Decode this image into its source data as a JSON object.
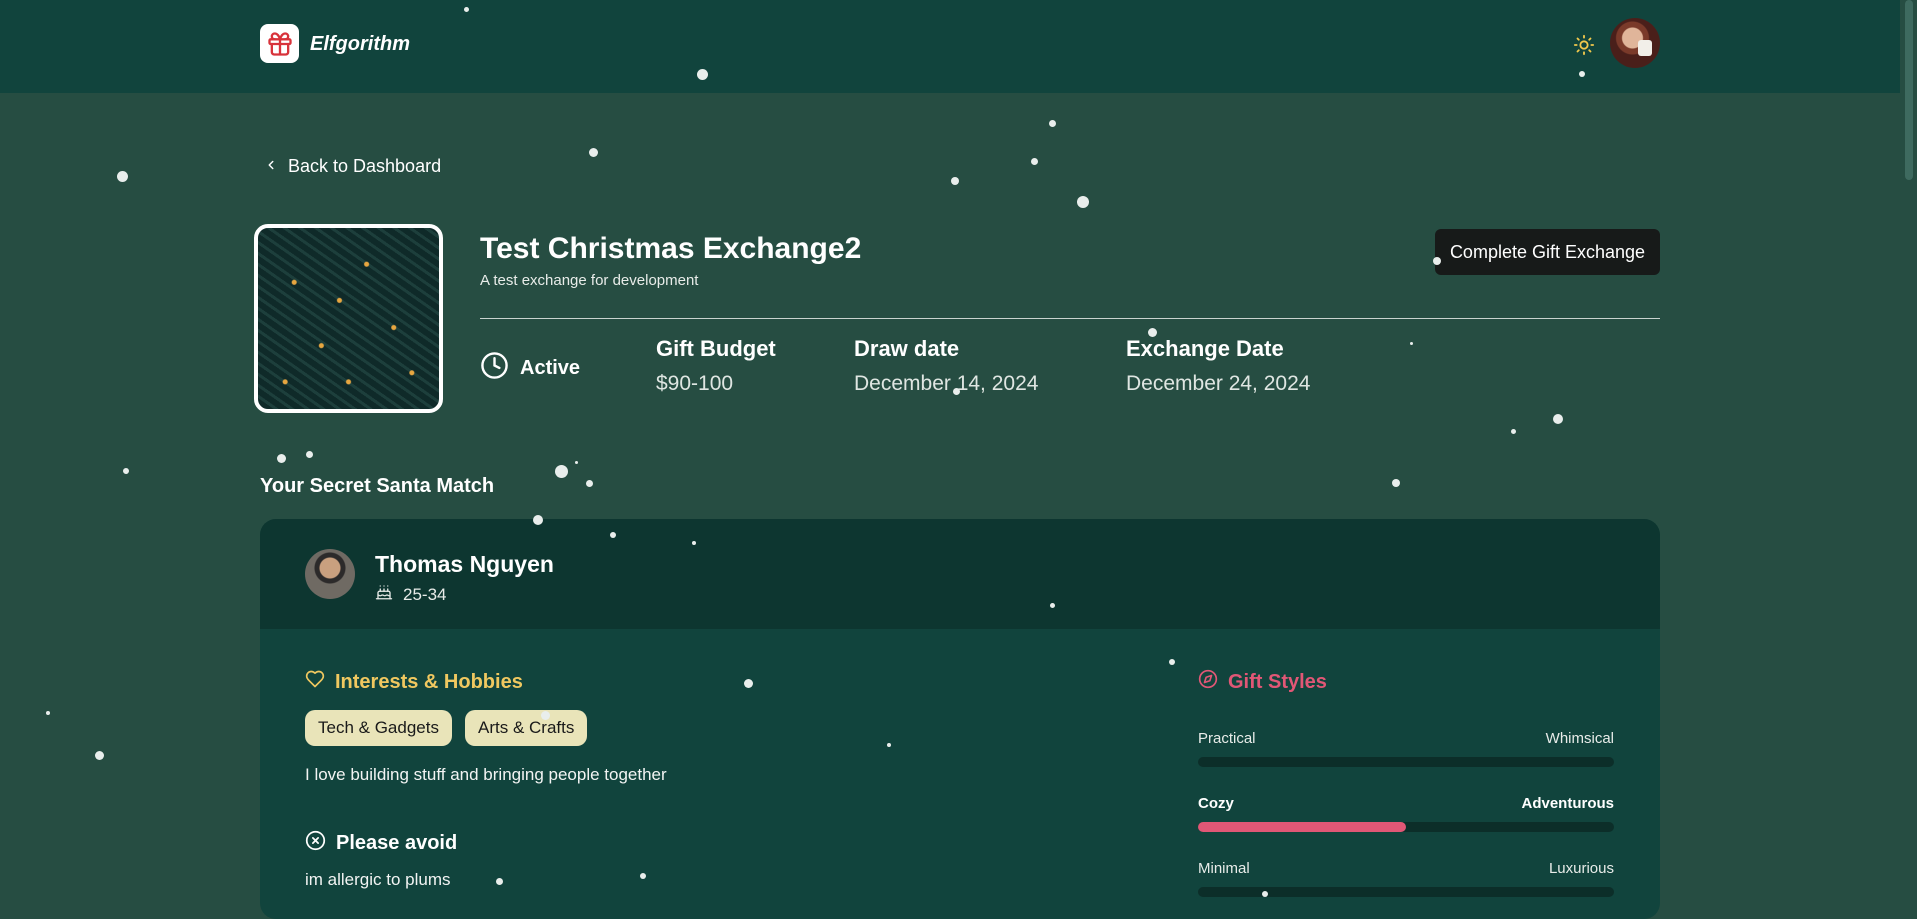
{
  "app": {
    "brand": "Elfgorithm"
  },
  "nav": {
    "back_label": "Back to Dashboard"
  },
  "exchange": {
    "title": "Test Christmas Exchange2",
    "description": "A test exchange for development",
    "complete_button": "Complete Gift Exchange",
    "status": "Active",
    "stats": [
      {
        "label": "Gift Budget",
        "value": "$90-100"
      },
      {
        "label": "Draw date",
        "value": "December 14, 2024"
      },
      {
        "label": "Exchange Date",
        "value": "December 24, 2024"
      }
    ]
  },
  "match": {
    "section_title": "Your Secret Santa Match",
    "name": "Thomas Nguyen",
    "age_range": "25-34",
    "interests_title": "Interests & Hobbies",
    "tags": [
      "Tech & Gadgets",
      "Arts & Crafts"
    ],
    "interests_text": "I love building stuff and bringing people together",
    "avoid_title": "Please avoid",
    "avoid_text": "im allergic to plums",
    "gift_styles_title": "Gift Styles",
    "gift_styles": [
      {
        "left": "Practical",
        "right": "Whimsical",
        "fill": 0
      },
      {
        "left": "Cozy",
        "right": "Adventurous",
        "fill": 0.5
      },
      {
        "left": "Minimal",
        "right": "Luxurious",
        "fill": 0
      }
    ]
  },
  "colors": {
    "page_bg": "#264d42",
    "header_bg": "#11443d",
    "card_bg": "#11443d",
    "interest_accent": "#f0c860",
    "gift_style_accent": "#e15776",
    "tag_bg": "#e9e4b9"
  },
  "icons": {
    "logo": "gift-icon",
    "theme": "sun-icon",
    "back": "chevron-left-icon",
    "status": "clock-icon",
    "age": "cake-icon",
    "interests": "heart-icon",
    "avoid": "x-circle-icon",
    "gift_styles": "compass-icon"
  }
}
